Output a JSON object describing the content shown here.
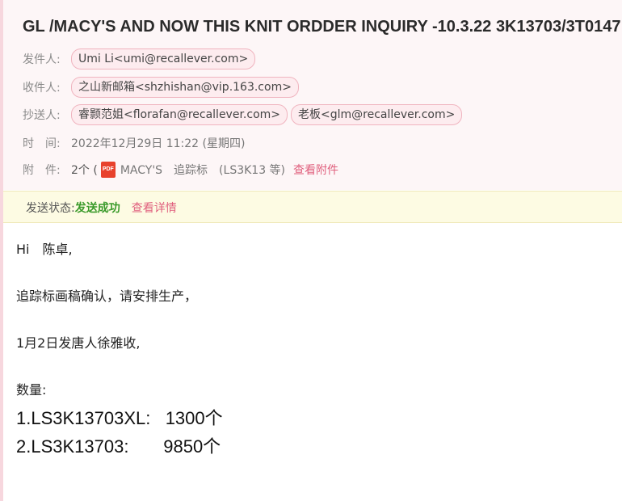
{
  "email": {
    "subject": "GL /MACY'S AND NOW THIS KNIT ORDDER INQUIRY -10.3.22 3K13703/3T0147",
    "from_label": "发件人:",
    "from": "Umi Li<umi@recallever.com>",
    "to_label": "收件人:",
    "to": "之山新邮箱<shzhishan@vip.163.com>",
    "cc_label": "抄送人:",
    "cc": [
      "睿颢范姐<florafan@recallever.com>",
      "老板<glm@recallever.com>"
    ],
    "time_label": "时　间:",
    "time": "2022年12月29日 11:22 (星期四)",
    "attach_label": "附　件:",
    "attach_count": "2个 (",
    "attach_icon": "pdf-icon",
    "attach_icon_text": "PDF",
    "attach_names": "MACY'S　追踪标　(LS3K13 等)",
    "attach_link": "查看附件"
  },
  "status": {
    "label": "发送状态:",
    "value": "发送成功",
    "detail_link": "查看详情",
    "value_color": "#3a9a2a"
  },
  "body": {
    "greeting": "Hi　陈卓,",
    "line1": "追踪标画稿确认，请安排生产，",
    "line2": "1月2日发唐人徐雅收,",
    "qty_label": "数量:",
    "qty1": "1.LS3K13703XL:   1300个",
    "qty2": "2.LS3K13703:       9850个"
  },
  "colors": {
    "accent": "#e0607e",
    "header_bg": "#fdf6f7",
    "status_bg": "#fdfbe3"
  }
}
